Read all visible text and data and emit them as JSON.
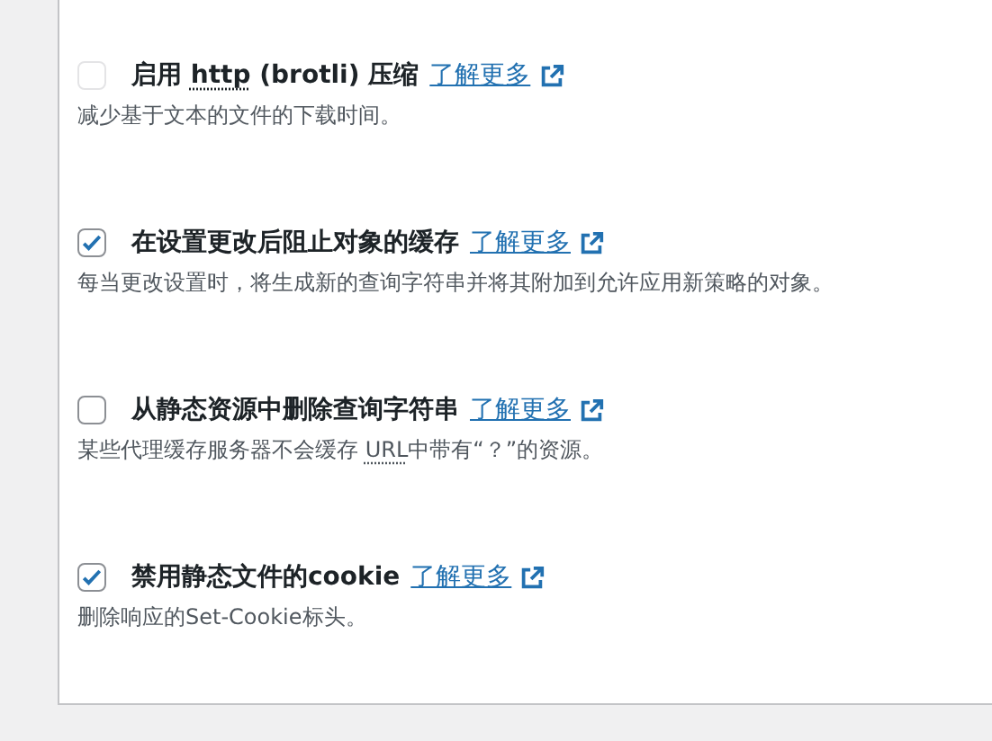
{
  "options": [
    {
      "checked": false,
      "disabled": true,
      "label_parts": [
        {
          "text": "启用 ",
          "abbr": false
        },
        {
          "text": "http",
          "abbr": true
        },
        {
          "text": " (brotli) 压缩",
          "abbr": false
        }
      ],
      "link": "了解更多",
      "description_parts": [
        {
          "text": "减少基于文本的文件的下载时间。",
          "abbr": false
        }
      ]
    },
    {
      "checked": true,
      "disabled": false,
      "label_parts": [
        {
          "text": "在设置更改后阻止对象的缓存",
          "abbr": false
        }
      ],
      "link": "了解更多",
      "description_parts": [
        {
          "text": "每当更改设置时，将生成新的查询字符串并将其附加到允许应用新策略的对象。",
          "abbr": false
        }
      ]
    },
    {
      "checked": false,
      "disabled": false,
      "label_parts": [
        {
          "text": "从静态资源中删除查询字符串",
          "abbr": false
        }
      ],
      "link": "了解更多",
      "description_parts": [
        {
          "text": "某些代理缓存服务器不会缓存 ",
          "abbr": false
        },
        {
          "text": "URL",
          "abbr": true
        },
        {
          "text": "中带有“？”的资源。",
          "abbr": false
        }
      ]
    },
    {
      "checked": true,
      "disabled": false,
      "label_parts": [
        {
          "text": "禁用静态文件的cookie",
          "abbr": false
        }
      ],
      "link": "了解更多",
      "description_parts": [
        {
          "text": "删除响应的Set-Cookie标头。",
          "abbr": false
        }
      ]
    }
  ]
}
